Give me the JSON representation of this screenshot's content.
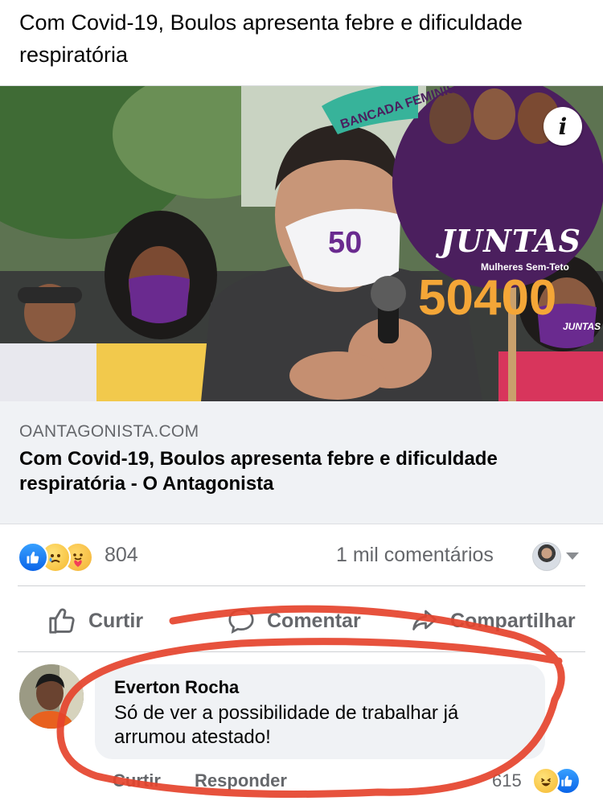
{
  "post": {
    "text": "Com Covid-19, Boulos apresenta febre e dificuldade respiratória"
  },
  "link_card": {
    "domain": "OANTAGONISTA.COM",
    "title": "Com Covid-19, Boulos apresenta febre e dificuldade respiratória - O Antagonista",
    "info_icon": "i",
    "image": {
      "sign_brand": "JUNTAS",
      "sign_subtitle": "Mulheres Sem-Teto",
      "sign_number": "50400",
      "mask_number": "50",
      "banner_text": "BANCADA FEMINISTA",
      "mask_text": "JUNTAS"
    }
  },
  "reactions": {
    "icons": [
      "like-icon",
      "sad-icon",
      "care-icon"
    ],
    "count": "804",
    "comments": "1 mil comentários"
  },
  "actions": {
    "like": "Curtir",
    "comment": "Comentar",
    "share": "Compartilhar"
  },
  "comment": {
    "author": "Everton Rocha",
    "text": "Só de ver a possibilidade de trabalhar já arrumou atestado!",
    "like_label": "Curtir",
    "reply_label": "Responder",
    "reaction_count": "615",
    "reaction_icons": [
      "haha-icon",
      "like-icon"
    ]
  },
  "colors": {
    "facebook_blue": "#1877f2",
    "secondary_text": "#65676b",
    "annotation_red": "#e5432c",
    "sign_purple": "#4b1f5e",
    "sign_orange": "#f4a637"
  }
}
